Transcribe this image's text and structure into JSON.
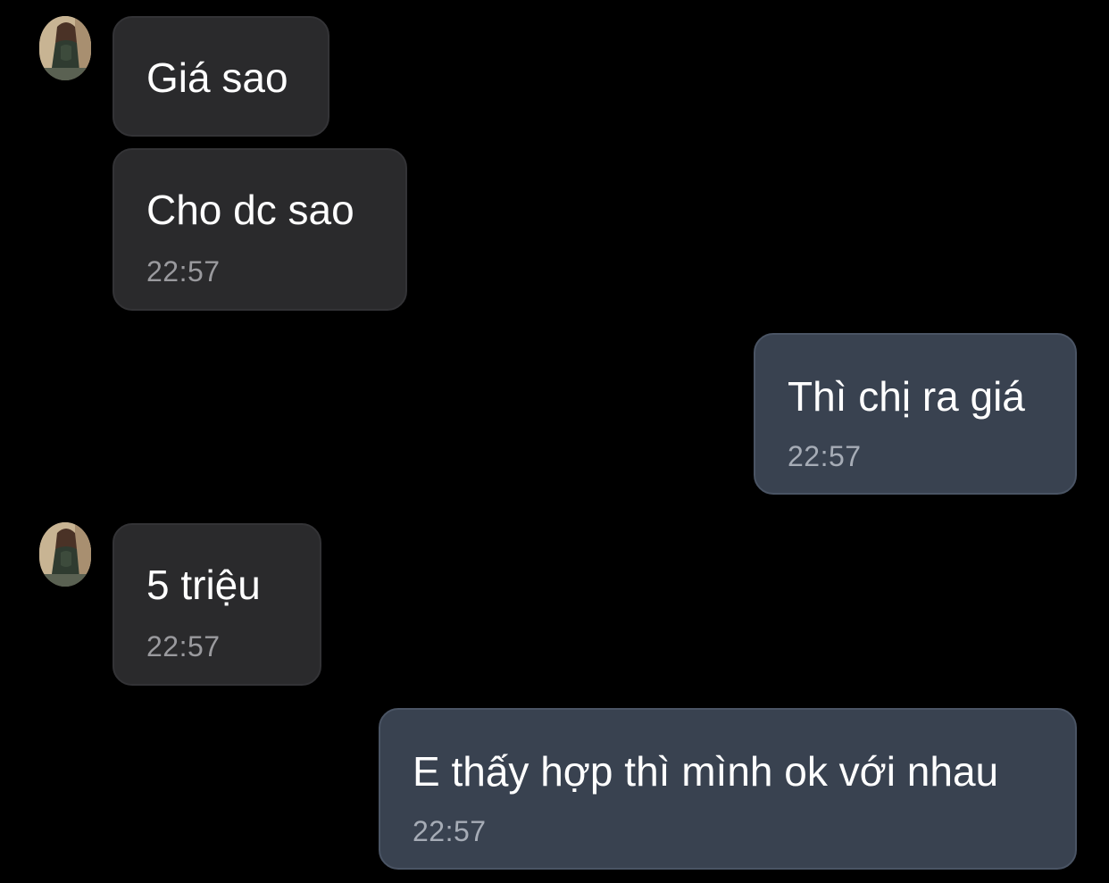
{
  "chat": {
    "messages": [
      {
        "direction": "incoming",
        "text": "Giá sao",
        "time": ""
      },
      {
        "direction": "incoming",
        "text": "Cho dc sao",
        "time": "22:57"
      },
      {
        "direction": "outgoing",
        "text": "Thì chị ra giá",
        "time": "22:57"
      },
      {
        "direction": "incoming",
        "text": "5 triệu",
        "time": "22:57"
      },
      {
        "direction": "outgoing",
        "text": "E thấy hợp thì mình ok với nhau",
        "time": "22:57"
      }
    ]
  },
  "colors": {
    "background": "#000000",
    "incoming_bubble": "#2a2a2c",
    "outgoing_bubble": "#394250",
    "text": "#ffffff",
    "timestamp": "#9a9a9e"
  },
  "icons": {
    "avatar": "contact-avatar-photo"
  }
}
